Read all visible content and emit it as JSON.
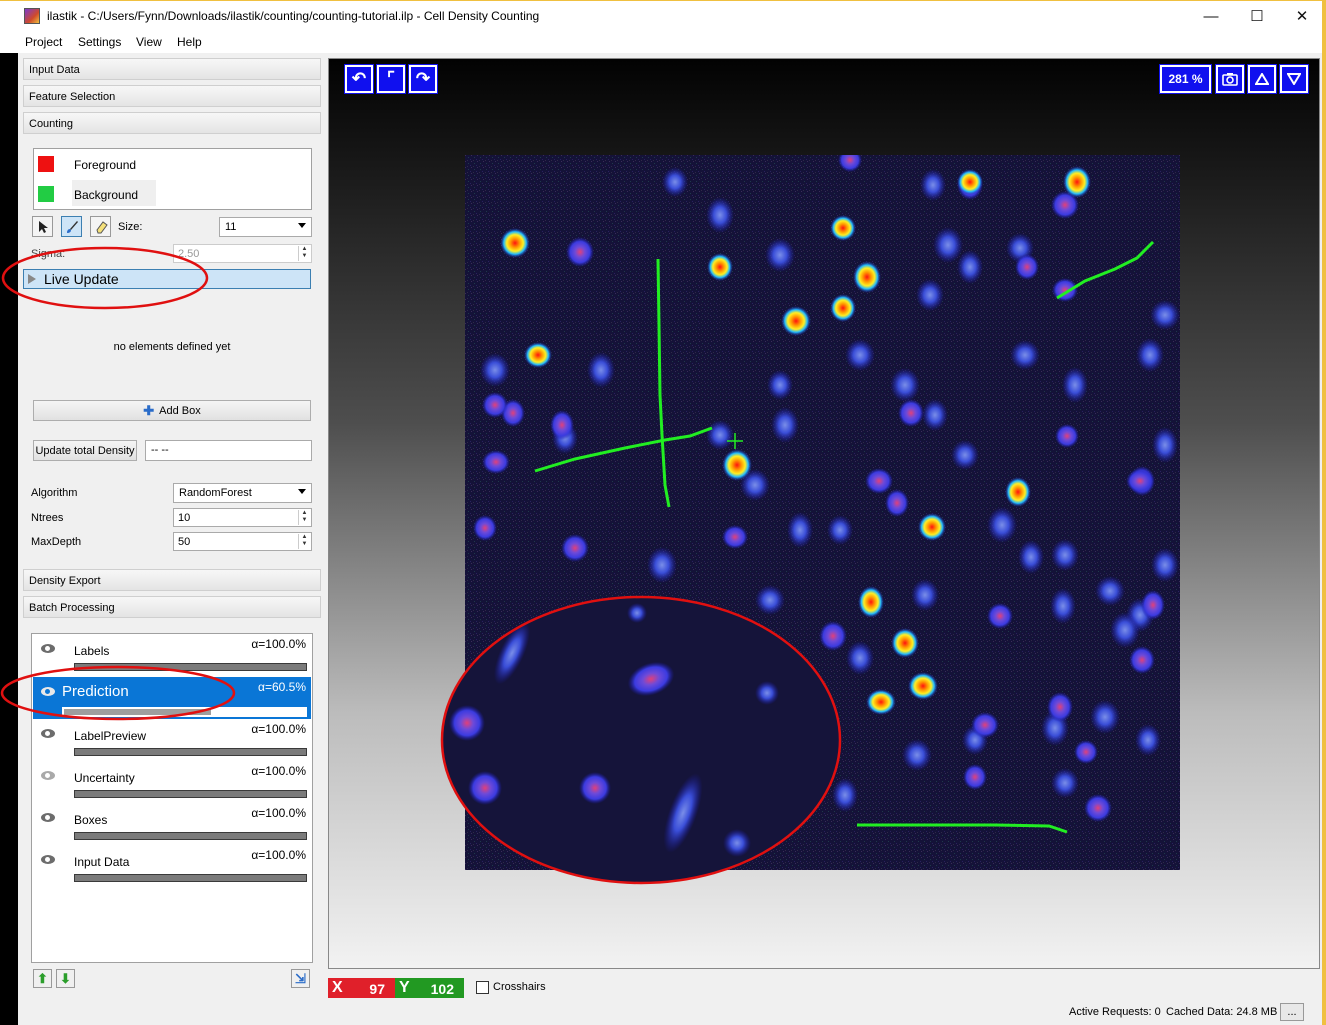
{
  "window": {
    "title": "ilastik - C:/Users/Fynn/Downloads/ilastik/counting/counting-tutorial.ilp - Cell Density Counting",
    "minimize": "—",
    "maximize": "☐",
    "close": "✕"
  },
  "menu": [
    "Project",
    "Settings",
    "View",
    "Help"
  ],
  "applets": {
    "input_data": "Input Data",
    "feature_selection": "Feature Selection",
    "counting": "Counting",
    "density_export": "Density Export",
    "batch_processing": "Batch Processing"
  },
  "labels": [
    {
      "name": "Foreground",
      "color": "#ee1111"
    },
    {
      "name": "Background",
      "color": "#22cc44"
    }
  ],
  "tools": {
    "size_label": "Size:",
    "size_value": "11",
    "sigma_label": "Sigma:",
    "sigma_value": "2.50"
  },
  "live_update": "Live Update",
  "boxes": {
    "empty_text": "no elements defined yet",
    "add_box": "Add Box",
    "update_total": "Update total Density",
    "total_value": "-- --"
  },
  "classifier": {
    "algorithm_label": "Algorithm",
    "algorithm_value": "RandomForest",
    "ntrees_label": "Ntrees",
    "ntrees_value": "10",
    "maxdepth_label": "MaxDepth",
    "maxdepth_value": "50"
  },
  "layers": [
    {
      "name": "Labels",
      "opacity": "α=100.0%",
      "selected": false
    },
    {
      "name": "Prediction",
      "opacity": "α=60.5%",
      "selected": true
    },
    {
      "name": "LabelPreview",
      "opacity": "α=100.0%",
      "selected": false
    },
    {
      "name": "Uncertainty",
      "opacity": "α=100.0%",
      "selected": false
    },
    {
      "name": "Boxes",
      "opacity": "α=100.0%",
      "selected": false
    },
    {
      "name": "Input Data",
      "opacity": "α=100.0%",
      "selected": false
    }
  ],
  "viewer": {
    "zoom": "281 %"
  },
  "coords": {
    "x_label": "X",
    "x": "97",
    "y_label": "Y",
    "y": "102"
  },
  "crosshairs": "Crosshairs",
  "status": {
    "active_requests": "Active Requests: 0",
    "cached_data": "Cached Data: 24.8 MB",
    "more": "..."
  },
  "colors": {
    "selection_blue": "#0a76d6",
    "viewer_button_blue": "#1010ef",
    "annotation_red": "#e01010",
    "brush_green": "#22ee22",
    "x_red": "#e0202a",
    "y_green": "#229922"
  }
}
